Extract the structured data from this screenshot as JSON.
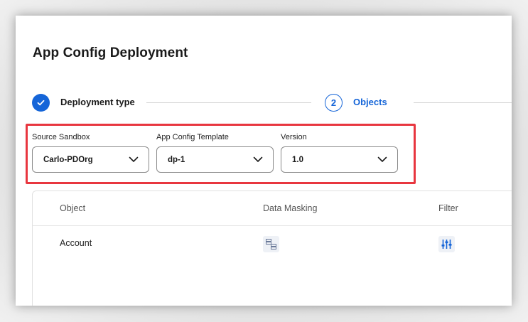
{
  "page": {
    "title": "App Config Deployment"
  },
  "stepper": {
    "step1": {
      "label": "Deployment type",
      "state": "complete"
    },
    "step2": {
      "number": "2",
      "label": "Objects",
      "state": "active"
    }
  },
  "fields": {
    "source_sandbox": {
      "label": "Source Sandbox",
      "value": "Carlo-PDOrg"
    },
    "template": {
      "label": "App Config Template",
      "value": "dp-1"
    },
    "version": {
      "label": "Version",
      "value": "1.0"
    }
  },
  "table": {
    "columns": [
      "Object",
      "Data Masking",
      "Filter"
    ],
    "rows": [
      {
        "object": "Account",
        "data_masking_icon": "data-masking-icon",
        "filter_icon": "filter-sliders-icon"
      }
    ]
  },
  "colors": {
    "accent": "#1565d8",
    "highlight": "#e8363f"
  }
}
